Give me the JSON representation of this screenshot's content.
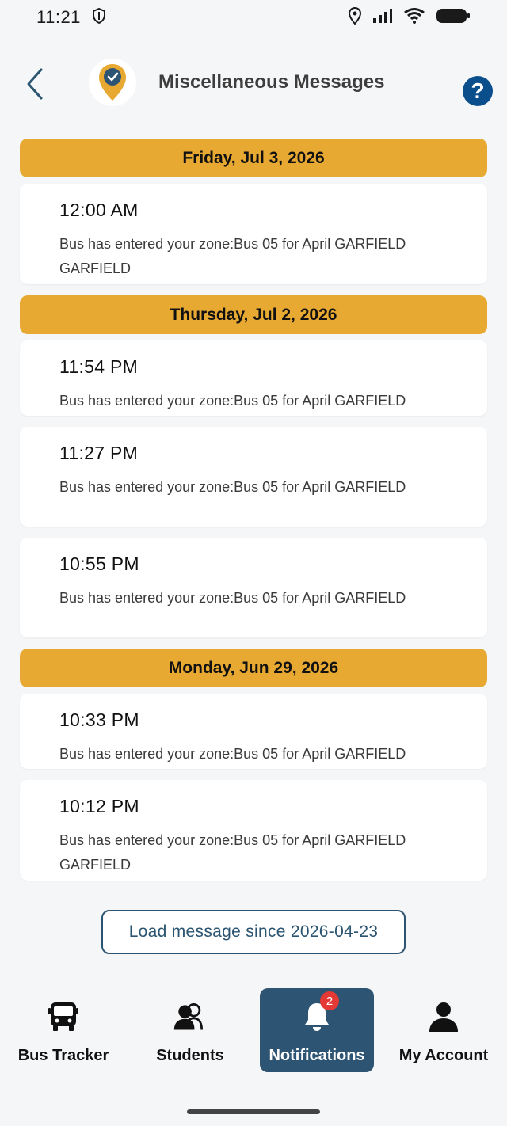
{
  "status": {
    "time": "11:21",
    "icons": [
      "shield-icon",
      "location-icon",
      "signal-icon",
      "wifi-icon",
      "battery-icon"
    ]
  },
  "header": {
    "title": "Miscellaneous Messages",
    "help_label": "?",
    "back_icon": "chevron-left-icon",
    "logo_icon": "location-check-icon"
  },
  "groups": [
    {
      "date": "Friday, Jul 3, 2026",
      "messages": [
        {
          "time": "12:00 AM",
          "text": "Bus has entered your zone:Bus 05 for April GARFIELD GARFIELD"
        }
      ]
    },
    {
      "date": "Thursday, Jul 2, 2026",
      "messages": [
        {
          "time": "11:54 PM",
          "text": "Bus has entered your zone:Bus 05 for April GARFIELD"
        },
        {
          "time": "11:27 PM",
          "text": "Bus has entered your zone:Bus 05 for April GARFIELD"
        },
        {
          "time": "10:55 PM",
          "text": "Bus has entered your zone:Bus 05 for April GARFIELD"
        }
      ]
    },
    {
      "date": "Monday, Jun 29, 2026",
      "messages": [
        {
          "time": "10:33 PM",
          "text": "Bus has entered your zone:Bus 05 for April GARFIELD"
        },
        {
          "time": "10:12 PM",
          "text": "Bus has entered your zone:Bus 05 for April GARFIELD GARFIELD"
        }
      ]
    }
  ],
  "load_button": "Load message since 2026-04-23",
  "nav": {
    "bus_tracker": "Bus Tracker",
    "students": "Students",
    "notifications": "Notifications",
    "notifications_badge": "2",
    "my_account": "My Account",
    "active": "notifications"
  },
  "colors": {
    "accent": "#e8a933",
    "nav_active": "#2d5473",
    "help": "#0b4e8c",
    "badge": "#e53935"
  }
}
